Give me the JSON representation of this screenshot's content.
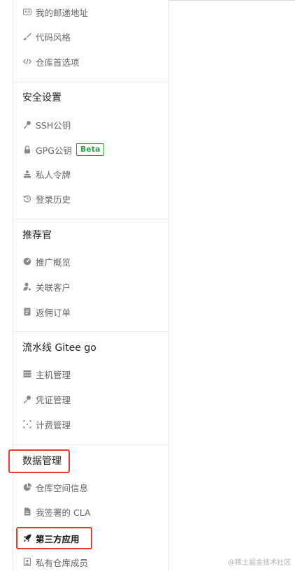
{
  "groups": {
    "account": {
      "items": [
        {
          "label": "我的邮递地址",
          "icon": "address-card-icon"
        },
        {
          "label": "代码风格",
          "icon": "brush-icon"
        },
        {
          "label": "仓库首选项",
          "icon": "code-icon"
        }
      ]
    },
    "security": {
      "title": "安全设置",
      "items": [
        {
          "label": "SSH公钥",
          "icon": "key-icon"
        },
        {
          "label": "GPG公钥",
          "icon": "lock-icon",
          "badge": "Beta"
        },
        {
          "label": "私人令牌",
          "icon": "token-icon"
        },
        {
          "label": "登录历史",
          "icon": "history-icon"
        }
      ]
    },
    "promoter": {
      "title": "推荐官",
      "items": [
        {
          "label": "推广概览",
          "icon": "dashboard-icon"
        },
        {
          "label": "关联客户",
          "icon": "user-link-icon"
        },
        {
          "label": "返佣订单",
          "icon": "order-icon"
        }
      ]
    },
    "pipeline": {
      "title": "流水线 Gitee go",
      "items": [
        {
          "label": "主机管理",
          "icon": "server-icon"
        },
        {
          "label": "凭证管理",
          "icon": "credential-key-icon"
        },
        {
          "label": "计费管理",
          "icon": "billing-icon"
        }
      ]
    },
    "data": {
      "title": "数据管理",
      "items": [
        {
          "label": "仓库空间信息",
          "icon": "pie-chart-icon"
        },
        {
          "label": "我签署的 CLA",
          "icon": "document-icon"
        },
        {
          "label": "第三方应用",
          "icon": "rocket-icon"
        },
        {
          "label": "私有仓库成员",
          "icon": "members-icon"
        }
      ]
    }
  },
  "watermark": "@稀土掘金技术社区",
  "colors": {
    "highlight_box": "#e53935",
    "badge": "#2f9e44"
  }
}
